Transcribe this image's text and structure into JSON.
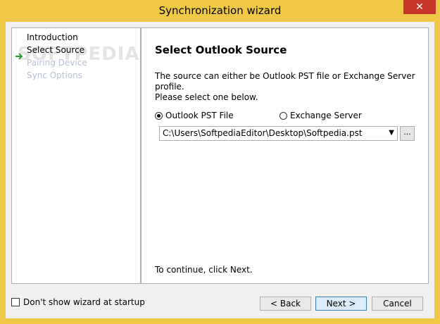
{
  "window": {
    "title": "Synchronization wizard",
    "close_label": "✕"
  },
  "sidebar": {
    "watermark": "SOFTPEDIA",
    "steps": [
      {
        "label": "Introduction",
        "state": "done"
      },
      {
        "label": "Select Source",
        "state": "current"
      },
      {
        "label": "Pairing Device",
        "state": "todo"
      },
      {
        "label": "Sync Options",
        "state": "todo"
      }
    ]
  },
  "main": {
    "heading": "Select Outlook Source",
    "desc_line1": "The source can either be Outlook PST file or Exchange Server profile.",
    "desc_line2": "Please select one below.",
    "radio_pst_label": "Outlook PST File",
    "radio_pst_selected": true,
    "radio_exchange_label": "Exchange Server",
    "radio_exchange_selected": false,
    "path_value": "C:\\Users\\SoftpediaEditor\\Desktop\\Softpedia.pst",
    "browse_label": "...",
    "hint": "To continue, click Next."
  },
  "footer": {
    "checkbox_label": "Don't show wizard at startup",
    "checkbox_checked": false,
    "back_label": "< Back",
    "next_label": "Next >",
    "cancel_label": "Cancel"
  },
  "colors": {
    "title_bar": "#f0c848",
    "close_button": "#c7362b",
    "arrow": "#2e9b3a",
    "pending_step": "#b6c1d3"
  }
}
